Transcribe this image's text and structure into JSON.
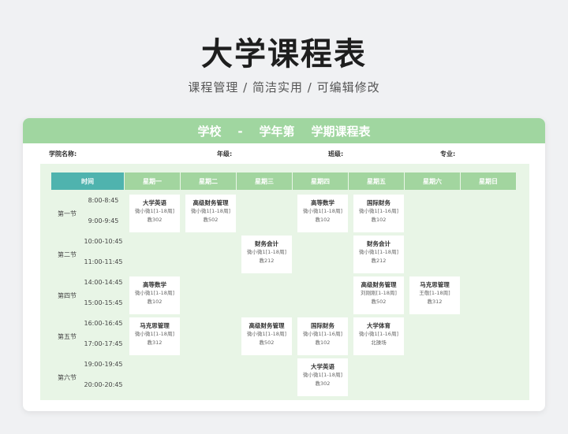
{
  "page": {
    "title": "大学课程表",
    "subtitle": "课程管理 / 简洁实用 / 可编辑修改"
  },
  "card": {
    "header": "学校    -    学年第    学期课程表",
    "info": {
      "college": "学院名称:",
      "grade": "年级:",
      "class": "班级:",
      "major": "专业:"
    }
  },
  "table": {
    "time_header": "时间",
    "days": [
      "星期一",
      "星期二",
      "星期三",
      "星期四",
      "星期五",
      "星期六",
      "星期日"
    ],
    "periods": [
      {
        "label": "第一节",
        "times": [
          "8:00-8:45",
          "9:00-9:45"
        ]
      },
      {
        "label": "第二节",
        "times": [
          "10:00-10:45",
          "11:00-11:45"
        ]
      },
      {
        "label": "第四节",
        "times": [
          "14:00-14:45",
          "15:00-15:45"
        ]
      },
      {
        "label": "第五节",
        "times": [
          "16:00-16:45",
          "17:00-17:45"
        ]
      },
      {
        "label": "第六节",
        "times": [
          "19:00-19:45",
          "20:00-20:45"
        ]
      }
    ],
    "courses": [
      {
        "period": 0,
        "day": 0,
        "name": "大学英语",
        "weeks": "微小微1[1-18周]",
        "room": "教302"
      },
      {
        "period": 0,
        "day": 1,
        "name": "高级财务管理",
        "weeks": "微小微1[1-18周]",
        "room": "教502"
      },
      {
        "period": 0,
        "day": 3,
        "name": "高等数学",
        "weeks": "微小微1[1-18周]",
        "room": "教102"
      },
      {
        "period": 0,
        "day": 4,
        "name": "国际财务",
        "weeks": "微小微1[1-16周]",
        "room": "教102"
      },
      {
        "period": 1,
        "day": 2,
        "name": "财务会计",
        "weeks": "微小微1[1-18周]",
        "room": "教212"
      },
      {
        "period": 1,
        "day": 4,
        "name": "财务会计",
        "weeks": "微小微1[1-18周]",
        "room": "教212"
      },
      {
        "period": 2,
        "day": 0,
        "name": "高等数学",
        "weeks": "微小微1[1-18周]",
        "room": "教102"
      },
      {
        "period": 2,
        "day": 4,
        "name": "高级财务管理",
        "weeks": "刘刚刚[1-18周]",
        "room": "教502"
      },
      {
        "period": 2,
        "day": 5,
        "name": "马克思管理",
        "weeks": "王敬[1-18周]",
        "room": "教312"
      },
      {
        "period": 3,
        "day": 0,
        "name": "马克思管理",
        "weeks": "微小微1[1-18周]",
        "room": "教312"
      },
      {
        "period": 3,
        "day": 2,
        "name": "高级财务管理",
        "weeks": "微小微1[1-18周]",
        "room": "教502"
      },
      {
        "period": 3,
        "day": 3,
        "name": "国际财务",
        "weeks": "微小微1[1-16周]",
        "room": "教102"
      },
      {
        "period": 3,
        "day": 4,
        "name": "大学体育",
        "weeks": "微小微1[1-16周]",
        "room": "北操场"
      },
      {
        "period": 4,
        "day": 3,
        "name": "大学英语",
        "weeks": "微小微1[1-18周]",
        "room": "教302"
      }
    ]
  },
  "colors": {
    "header_green": "#a0d6a0",
    "time_teal": "#4fb3ae",
    "grid_bg": "#e8f5e6"
  }
}
